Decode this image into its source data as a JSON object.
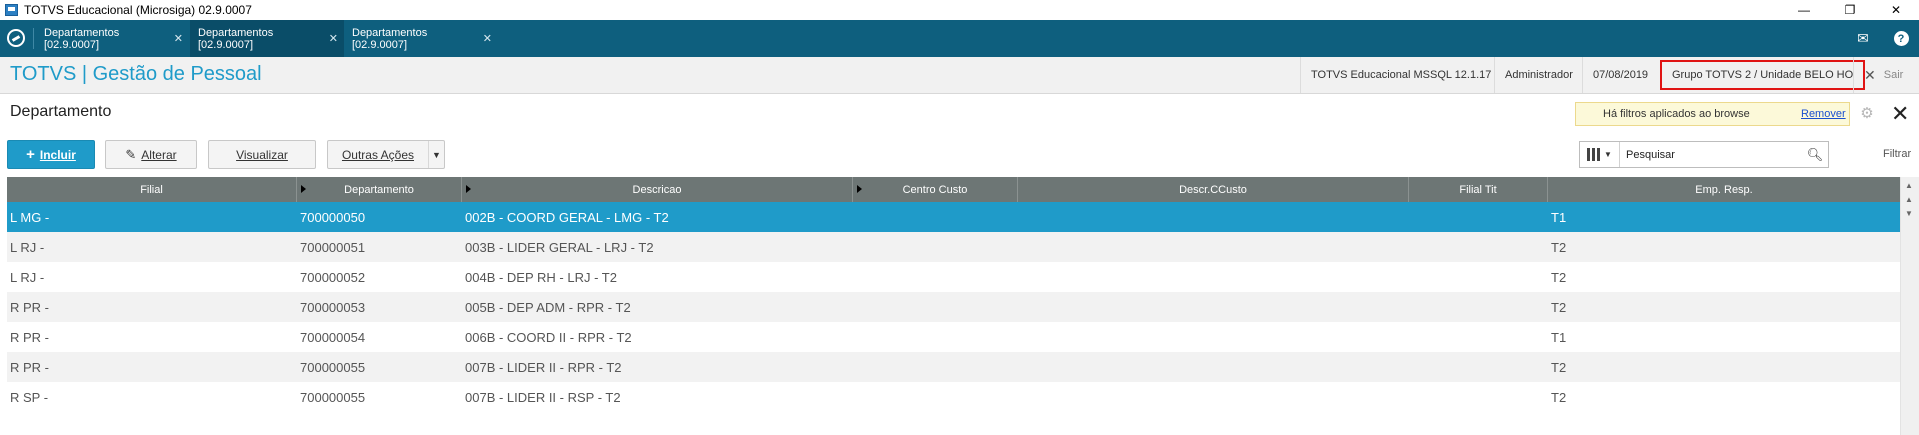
{
  "window": {
    "title": "TOTVS Educacional (Microsiga) 02.9.0007",
    "minimize": "—",
    "restore": "❐",
    "close": "✕"
  },
  "tabs": [
    {
      "label": "Departamentos [02.9.0007]",
      "close": "✕"
    },
    {
      "label": "Departamentos [02.9.0007]",
      "close": "✕"
    },
    {
      "label": "Departamentos [02.9.0007]",
      "close": "✕"
    }
  ],
  "header": {
    "brand": "TOTVS | Gestão de Pessoal",
    "environment": "TOTVS Educacional MSSQL 12.1.17",
    "user": "Administrador",
    "date": "07/08/2019",
    "group": "Grupo TOTVS 2 / Unidade BELO HO",
    "exit": "Sair"
  },
  "page": {
    "title": "Departamento",
    "filter_note": "Há filtros aplicados ao browse",
    "filter_remove": "Remover"
  },
  "toolbar": {
    "include": "Incluir",
    "edit": "Alterar",
    "view": "Visualizar",
    "other": "Outras Ações"
  },
  "search": {
    "value": "Pesquisar",
    "filter_label": "Filtrar"
  },
  "grid": {
    "columns": [
      "Filial",
      "Departamento",
      "Descricao",
      "Centro Custo",
      "Descr.CCusto",
      "Filial Tit",
      "Emp. Resp."
    ],
    "rows": [
      [
        "L MG    -",
        "700000050",
        "002B - COORD GERAL - LMG - T2",
        "",
        "",
        "",
        "T1"
      ],
      [
        "L RJ    -",
        "700000051",
        "003B - LIDER GERAL - LRJ - T2",
        "",
        "",
        "",
        "T2"
      ],
      [
        "L RJ    -",
        "700000052",
        "004B - DEP RH - LRJ - T2",
        "",
        "",
        "",
        "T2"
      ],
      [
        "R PR    -",
        "700000053",
        "005B - DEP ADM - RPR - T2",
        "",
        "",
        "",
        "T2"
      ],
      [
        "R PR    -",
        "700000054",
        "006B - COORD II - RPR - T2",
        "",
        "",
        "",
        "T1"
      ],
      [
        "R PR    -",
        "700000055",
        "007B - LIDER II - RPR - T2",
        "",
        "",
        "",
        "T2"
      ],
      [
        "R SP    -",
        "700000055",
        "007B - LIDER II - RSP - T2",
        "",
        "",
        "",
        "T2"
      ]
    ]
  },
  "colors": {
    "accent": "#1f9bc9",
    "tabbar": "#0e5f7e",
    "grid_header": "#6d7675",
    "highlight_border": "#e01414"
  }
}
